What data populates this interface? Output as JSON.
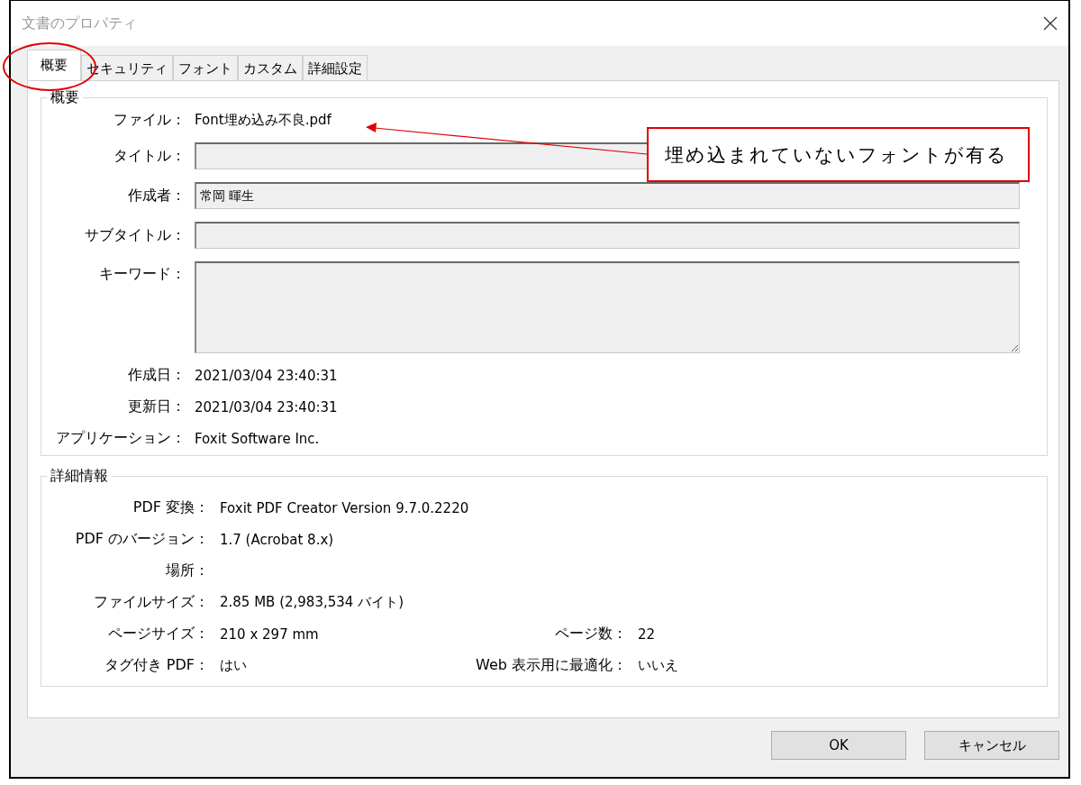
{
  "window": {
    "title": "文書のプロパティ"
  },
  "tabs": [
    {
      "label": "概要",
      "selected": true
    },
    {
      "label": "セキュリティ",
      "selected": false
    },
    {
      "label": "フォント",
      "selected": false
    },
    {
      "label": "カスタム",
      "selected": false
    },
    {
      "label": "詳細設定",
      "selected": false
    }
  ],
  "summary": {
    "title": "概要",
    "rows": [
      {
        "kind": "text",
        "label": "ファイル：",
        "value": "Font埋め込み不良.pdf"
      },
      {
        "kind": "field",
        "label": "タイトル："
      },
      {
        "kind": "field",
        "label": "作成者：",
        "value": "常岡 暉生"
      },
      {
        "kind": "field",
        "label": "サブタイトル："
      },
      {
        "kind": "area",
        "label": "キーワード："
      },
      {
        "kind": "text",
        "label": "作成日：",
        "value": "2021/03/04 23:40:31"
      },
      {
        "kind": "text",
        "label": "更新日：",
        "value": "2021/03/04 23:40:31"
      },
      {
        "kind": "text",
        "label": "アプリケーション：",
        "value": "Foxit Software Inc."
      }
    ]
  },
  "details": {
    "title": "詳細情報",
    "rows": [
      {
        "label": "PDF 変換：",
        "value": "Foxit PDF Creator Version 9.7.0.2220"
      },
      {
        "label": "PDF のバージョン：",
        "value": "1.7 (Acrobat 8.x)"
      },
      {
        "label": "場所："
      },
      {
        "label": "ファイルサイズ：",
        "value": "2.85 MB (2,983,534 バイト)"
      },
      {
        "label": "ページサイズ：",
        "value": "210 x 297 mm",
        "extra_label": "ページ数：",
        "extra_value": "22"
      },
      {
        "label": "タグ付き PDF：",
        "value": "はい",
        "extra_label": "Web 表示用に最適化：",
        "extra_value": "いいえ"
      }
    ]
  },
  "buttons": [
    "OK",
    "キャンセル"
  ],
  "callout": {
    "text": "埋め込まれていないフォントが有る"
  }
}
